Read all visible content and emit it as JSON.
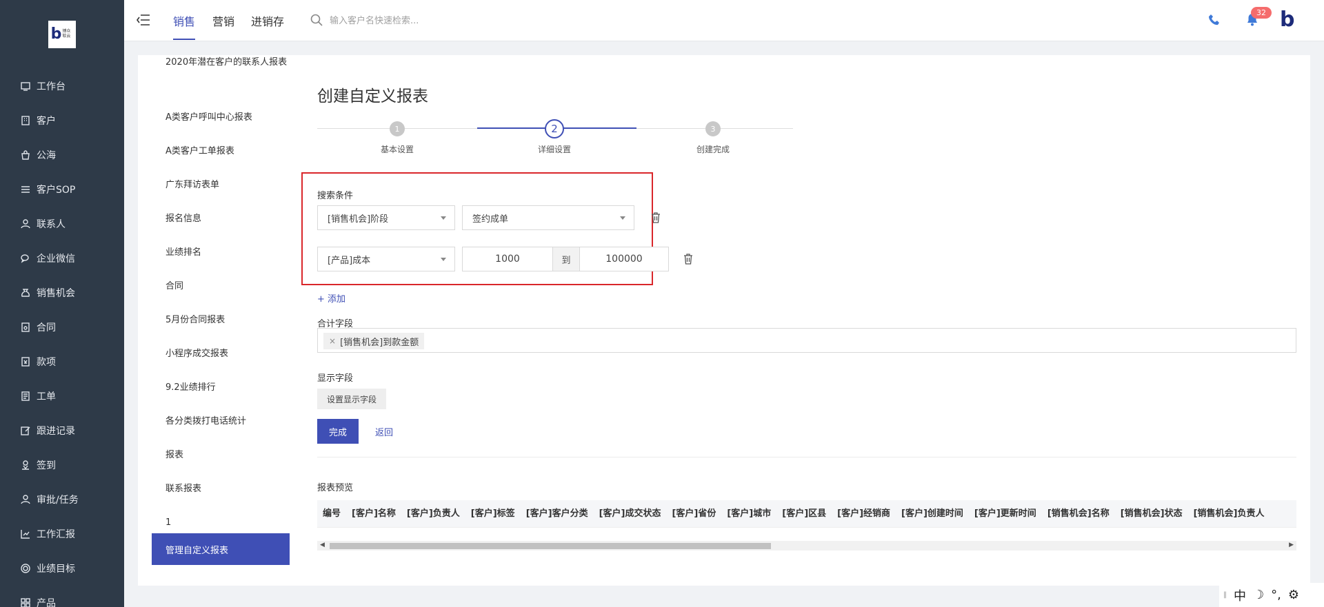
{
  "brand": {
    "logo_text": "博众软云"
  },
  "nav": {
    "items": [
      {
        "label": "工作台",
        "icon": "monitor-icon"
      },
      {
        "label": "客户",
        "icon": "building-icon"
      },
      {
        "label": "公海",
        "icon": "bag-icon"
      },
      {
        "label": "客户SOP",
        "icon": "sop-icon"
      },
      {
        "label": "联系人",
        "icon": "person-icon"
      },
      {
        "label": "企业微信",
        "icon": "wechat-icon"
      },
      {
        "label": "销售机会",
        "icon": "moneybag-icon"
      },
      {
        "label": "合同",
        "icon": "contract-icon"
      },
      {
        "label": "款项",
        "icon": "payment-icon"
      },
      {
        "label": "工单",
        "icon": "ticket-icon"
      },
      {
        "label": "跟进记录",
        "icon": "edit-icon"
      },
      {
        "label": "签到",
        "icon": "checkin-icon"
      },
      {
        "label": "审批/任务",
        "icon": "approval-icon"
      },
      {
        "label": "工作汇报",
        "icon": "report-icon"
      },
      {
        "label": "业绩目标",
        "icon": "target-icon"
      },
      {
        "label": "产品",
        "icon": "grid-icon"
      }
    ]
  },
  "topbar": {
    "tabs": [
      {
        "label": "销售",
        "active": true
      },
      {
        "label": "营销",
        "active": false
      },
      {
        "label": "进销存",
        "active": false
      }
    ],
    "search_placeholder": "输入客户名快速检索...",
    "notification_count": "32"
  },
  "report_list": {
    "items": [
      "2020年潜在客户的联系人报表",
      "A类客户呼叫中心报表",
      "A类客户工单报表",
      "广东拜访表单",
      "报名信息",
      "业绩排名",
      "合同",
      "5月份合同报表",
      "小程序成交报表",
      "9.2业绩排行",
      "各分类拨打电话统计",
      "报表",
      "联系报表",
      "1"
    ],
    "active_item": "管理自定义报表"
  },
  "page": {
    "title": "创建自定义报表",
    "steps": [
      {
        "num": "1",
        "label": "基本设置"
      },
      {
        "num": "2",
        "label": "详细设置"
      },
      {
        "num": "3",
        "label": "创建完成"
      }
    ],
    "current_step": 2,
    "conditions": {
      "label": "搜索条件",
      "row1": {
        "field": "[销售机会]阶段",
        "value": "签约成单"
      },
      "row2": {
        "field": "[产品]成本",
        "from": "1000",
        "to_label": "到",
        "to": "100000"
      }
    },
    "add_label": "+ 添加",
    "sum_fields": {
      "label": "合计字段",
      "tags": [
        "[销售机会]到款金额"
      ]
    },
    "display_fields": {
      "label": "显示字段",
      "button": "设置显示字段"
    },
    "finish_button": "完成",
    "back_link": "返回",
    "preview": {
      "label": "报表预览",
      "columns": [
        "编号",
        "[客户]名称",
        "[客户]负责人",
        "[客户]标签",
        "[客户]客户分类",
        "[客户]成交状态",
        "[客户]省份",
        "[客户]城市",
        "[客户]区县",
        "[客户]经销商",
        "[客户]创建时间",
        "[客户]更新时间",
        "[销售机会]名称",
        "[销售机会]状态",
        "[销售机会]负责人"
      ]
    }
  },
  "ime": {
    "lang": "中",
    "moon": "☽",
    "punct": "°,",
    "gear": "⚙"
  },
  "colors": {
    "accent": "#3f4fb5",
    "sidebar": "#2e3a48",
    "highlight_border": "#d9262a",
    "badge": "#f56c6c"
  }
}
